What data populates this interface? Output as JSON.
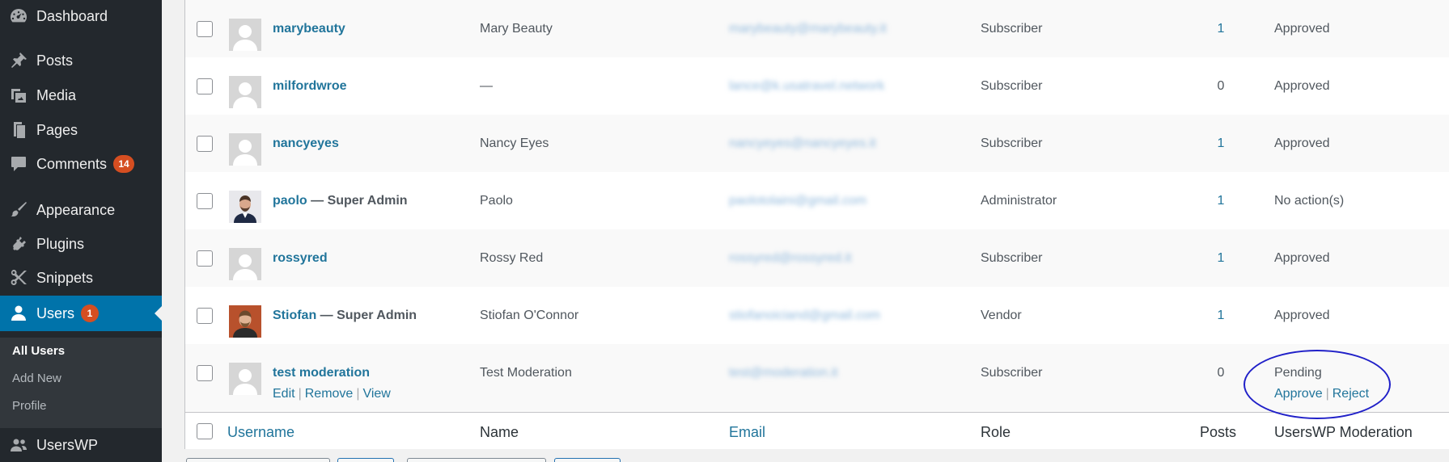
{
  "sidebar": {
    "items": [
      {
        "label": "Dashboard",
        "icon": "dashboard-icon"
      },
      {
        "label": "Posts",
        "icon": "pin-icon"
      },
      {
        "label": "Media",
        "icon": "media-icon"
      },
      {
        "label": "Pages",
        "icon": "pages-icon"
      },
      {
        "label": "Comments",
        "icon": "comments-icon",
        "badge": "14"
      },
      {
        "label": "Appearance",
        "icon": "paintbrush-icon"
      },
      {
        "label": "Plugins",
        "icon": "plugin-icon"
      },
      {
        "label": "Snippets",
        "icon": "scissors-icon"
      },
      {
        "label": "Users",
        "icon": "user-icon",
        "badge": "1",
        "current": true
      },
      {
        "label": "UsersWP",
        "icon": "userswp-icon"
      }
    ],
    "submenu": [
      {
        "label": "All Users",
        "current": true
      },
      {
        "label": "Add New"
      },
      {
        "label": "Profile"
      }
    ],
    "accent_color": "#0073aa",
    "badge_color": "#d54e21"
  },
  "table": {
    "rows": [
      {
        "username": "marybeauty",
        "suffix": "",
        "name": "Mary Beauty",
        "email": "marybeauty@marybeauty.it",
        "role": "Subscriber",
        "posts": "1",
        "moderation": "Approved",
        "avatar": "default"
      },
      {
        "username": "milfordwroe",
        "suffix": "",
        "name": "—",
        "email": "lance@k.usatravel.network",
        "role": "Subscriber",
        "posts": "0",
        "moderation": "Approved",
        "avatar": "default"
      },
      {
        "username": "nancyeyes",
        "suffix": "",
        "name": "Nancy Eyes",
        "email": "nancyeyes@nancyeyes.it",
        "role": "Subscriber",
        "posts": "1",
        "moderation": "Approved",
        "avatar": "default"
      },
      {
        "username": "paolo",
        "suffix": " — Super Admin",
        "name": "Paolo",
        "email": "paolotolaini@gmail.com",
        "role": "Administrator",
        "posts": "1",
        "moderation": "No action(s)",
        "avatar": "photo-paolo"
      },
      {
        "username": "rossyred",
        "suffix": "",
        "name": "Rossy Red",
        "email": "rossyred@rossyred.it",
        "role": "Subscriber",
        "posts": "1",
        "moderation": "Approved",
        "avatar": "default"
      },
      {
        "username": "Stiofan",
        "suffix": " — Super Admin",
        "name": "Stiofan O'Connor",
        "email": "stiofanoiciand@gmail.com",
        "role": "Vendor",
        "posts": "1",
        "moderation": "Approved",
        "avatar": "photo-stiofan"
      },
      {
        "username": "test moderation",
        "suffix": "",
        "name": "Test Moderation",
        "email": "test@moderation.it",
        "role": "Subscriber",
        "posts": "0",
        "moderation": "Pending",
        "avatar": "default",
        "row_actions": [
          "Edit",
          "Remove",
          "View"
        ],
        "moderation_actions": [
          "Approve",
          "Reject"
        ]
      }
    ],
    "footer_columns": {
      "username": "Username",
      "name": "Name",
      "email": "Email",
      "role": "Role",
      "posts": "Posts",
      "moderation": "UsersWP Moderation"
    },
    "link_color": "#21759b",
    "annotation_color": "#2020c8"
  }
}
